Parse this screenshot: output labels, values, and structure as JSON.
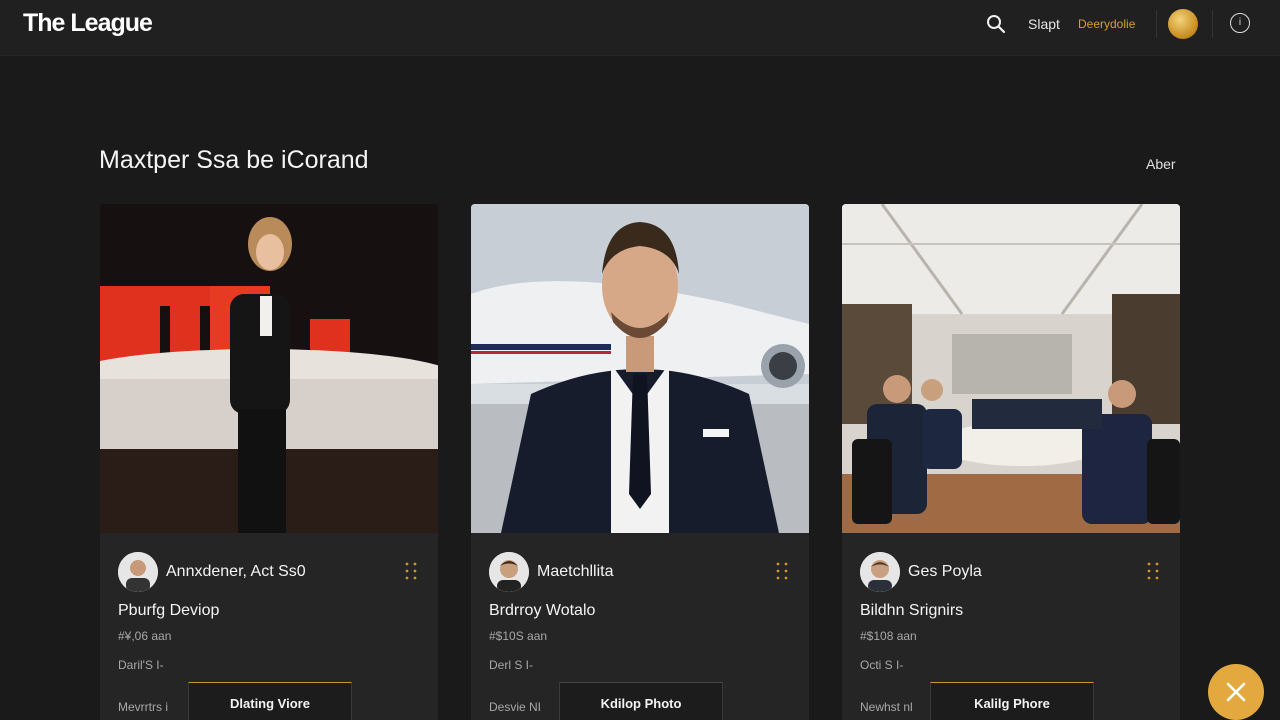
{
  "header": {
    "logo": "The League",
    "nav_link": "Slapt",
    "nav_link_gold": "Deerydolie",
    "info_icon_glyph": "i"
  },
  "section": {
    "title": "Maxtper Ssa be iCorand",
    "action": "Aber"
  },
  "cards": [
    {
      "name": "Annxdener, Act Ss0",
      "role": "Pburfg Deviop",
      "meta1": "#¥,06 aan",
      "meta2": "Daril'S I-",
      "meta3": "Mevrrtrs i",
      "button": "Dlating Viore",
      "photo": "woman-on-stage-photo"
    },
    {
      "name": "Maetchllita",
      "role": "Brdrroy Wotalo",
      "meta1": "#$10S aan",
      "meta2": "Derl S I-",
      "meta3": "Desvie NI",
      "button": "Kdilop Photo",
      "photo": "man-near-jet-photo"
    },
    {
      "name": "Ges Poyla",
      "role": "Bildhn Srignirs",
      "meta1": "#$108 aan",
      "meta2": "Octi S I-",
      "meta3": "Newhst nl",
      "button": "Kalilg Phore",
      "photo": "boardroom-meeting-photo"
    }
  ],
  "colors": {
    "accent_gold": "#e3a93f",
    "background": "#1a1a1a",
    "card": "#252525"
  }
}
